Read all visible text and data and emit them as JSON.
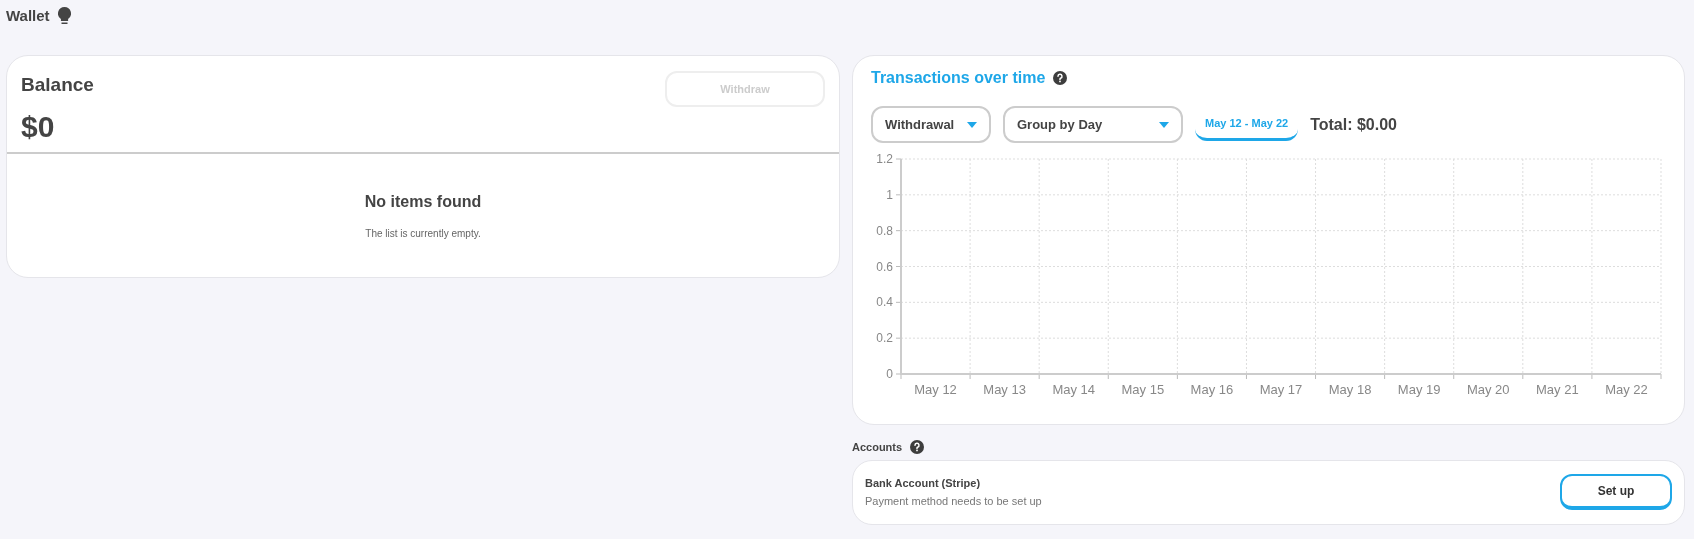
{
  "page_title": "Wallet",
  "balance": {
    "title": "Balance",
    "amount": "$0",
    "withdraw_button": {
      "label": "Withdraw",
      "disabled": true
    },
    "empty_title": "No items found",
    "empty_text": "The list is currently empty."
  },
  "transactions": {
    "title": "Transactions over time",
    "type_filter": "Withdrawal",
    "group_filter": "Group by Day",
    "date_range": "May 12 - May 22",
    "total": "Total: $0.00",
    "chart_data": {
      "type": "line",
      "categories": [
        "May 12",
        "May 13",
        "May 14",
        "May 15",
        "May 16",
        "May 17",
        "May 18",
        "May 19",
        "May 20",
        "May 21",
        "May 22"
      ],
      "ylim": [
        0,
        1.2
      ],
      "yticks": [
        0,
        0.2,
        0.4,
        0.6,
        0.8,
        1,
        1.2
      ],
      "grid": true
    }
  },
  "accounts": {
    "title": "Accounts",
    "items": [
      {
        "name": "Bank Account (Stripe)",
        "status": "Payment method needs to be set up",
        "button": "Set up"
      }
    ]
  }
}
